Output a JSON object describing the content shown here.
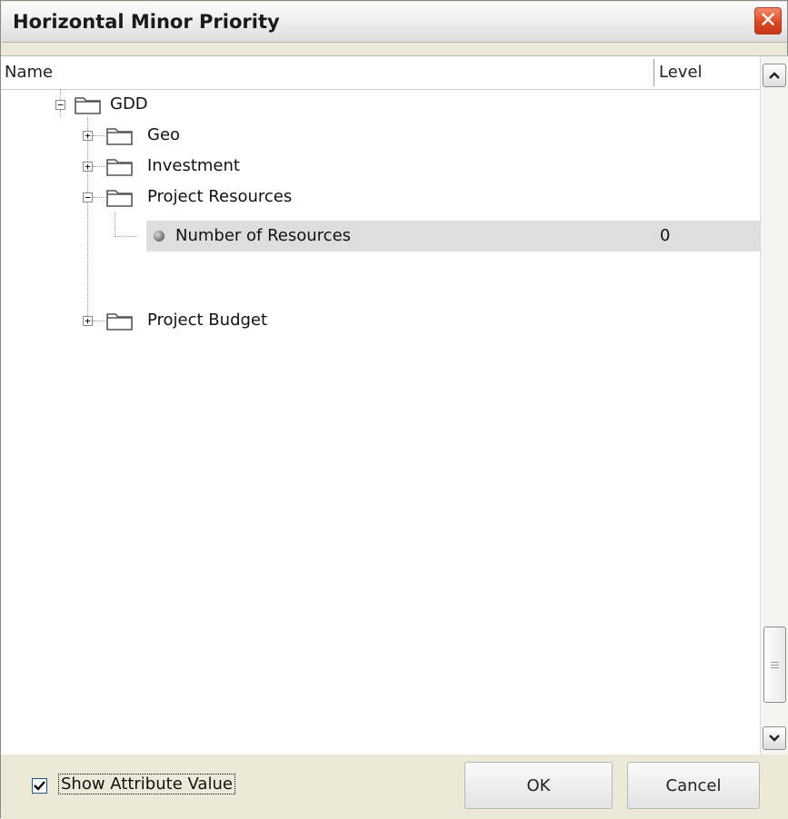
{
  "window": {
    "title": "Horizontal Minor Priority",
    "close_icon": "close-icon"
  },
  "columns": {
    "name": "Name",
    "level": "Level"
  },
  "tree": {
    "root": {
      "label": "GDD",
      "expanded": true
    },
    "items": [
      {
        "label": "Geo",
        "expanded": false
      },
      {
        "label": "Investment",
        "expanded": false
      },
      {
        "label": "Project Resources",
        "expanded": true
      },
      {
        "label": "Number of Resources",
        "level": "0",
        "selected": true
      },
      {
        "label": "Project Budget",
        "expanded": false
      }
    ]
  },
  "footer": {
    "show_attribute_label": "Show Attribute Value",
    "show_attribute_checked": true,
    "ok_label": "OK",
    "cancel_label": "Cancel"
  },
  "colors": {
    "selection": "#dedede",
    "close_button": "#d9441f",
    "dialog_bg": "#ece9d8"
  }
}
